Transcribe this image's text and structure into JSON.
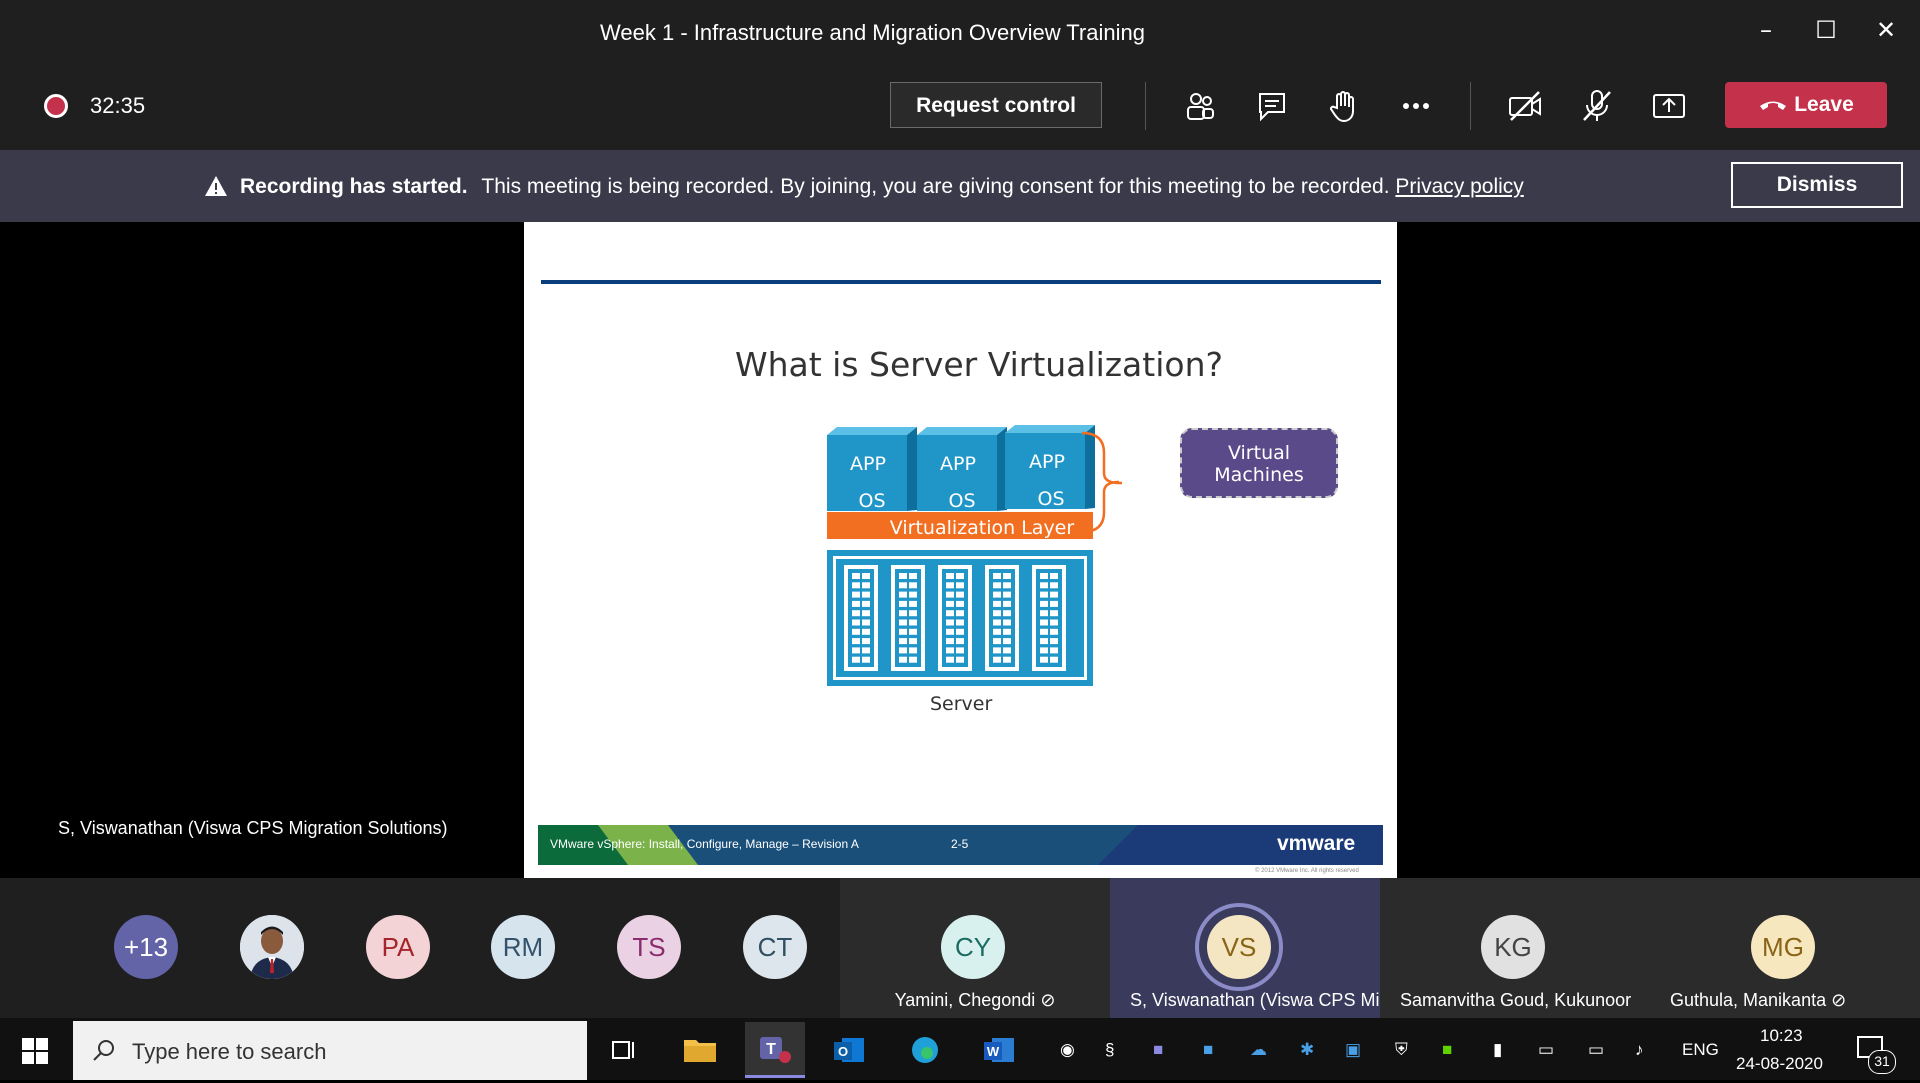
{
  "window": {
    "title": "Week 1 - Infrastructure and Migration Overview Training"
  },
  "toolbar": {
    "timer": "32:35",
    "request_control_label": "Request control",
    "leave_label": "Leave"
  },
  "banner": {
    "bold": "Recording has started.",
    "message": "This meeting is being recorded. By joining, you are giving consent for this meeting to be recorded.",
    "link": "Privacy policy",
    "dismiss_label": "Dismiss"
  },
  "slide": {
    "title": "What is Server Virtualization?",
    "app_label": "APP",
    "os_label": "OS",
    "virtualization_layer": "Virtualization Layer",
    "virtual_machines_line1": "Virtual",
    "virtual_machines_line2": "Machines",
    "server_label": "Server",
    "footer_course": "VMware vSphere: Install, Configure, Manage – Revision A",
    "footer_page": "2-5",
    "footer_logo": "vmware",
    "footer_copyright": "© 2012 VMware Inc. All rights reserved"
  },
  "presenter": {
    "name": "S, Viswanathan (Viswa CPS Migration Solutions)"
  },
  "participants": {
    "overflow_count": "+13",
    "avatars": [
      "PA",
      "RM",
      "TS",
      "CT"
    ],
    "tiles": [
      {
        "initials": "CY",
        "name": "Yamini, Chegondi"
      },
      {
        "initials": "VS",
        "name": "S, Viswanathan (Viswa CPS Mig"
      },
      {
        "initials": "KG",
        "name": "Samanvitha Goud, Kukunoor"
      },
      {
        "initials": "MG",
        "name": "Guthula, Manikanta"
      }
    ]
  },
  "taskbar": {
    "search_placeholder": "Type here to search",
    "language": "ENG",
    "time": "10:23",
    "date": "24-08-2020",
    "notification_count": "31"
  },
  "colors": {
    "leave": "#c4314b",
    "banner": "#3b3a4a",
    "slide_rule": "#0b3c7c",
    "vm_box": "#5a4a8a",
    "app_blue": "#1f95c8",
    "virt_orange": "#f26f21"
  }
}
